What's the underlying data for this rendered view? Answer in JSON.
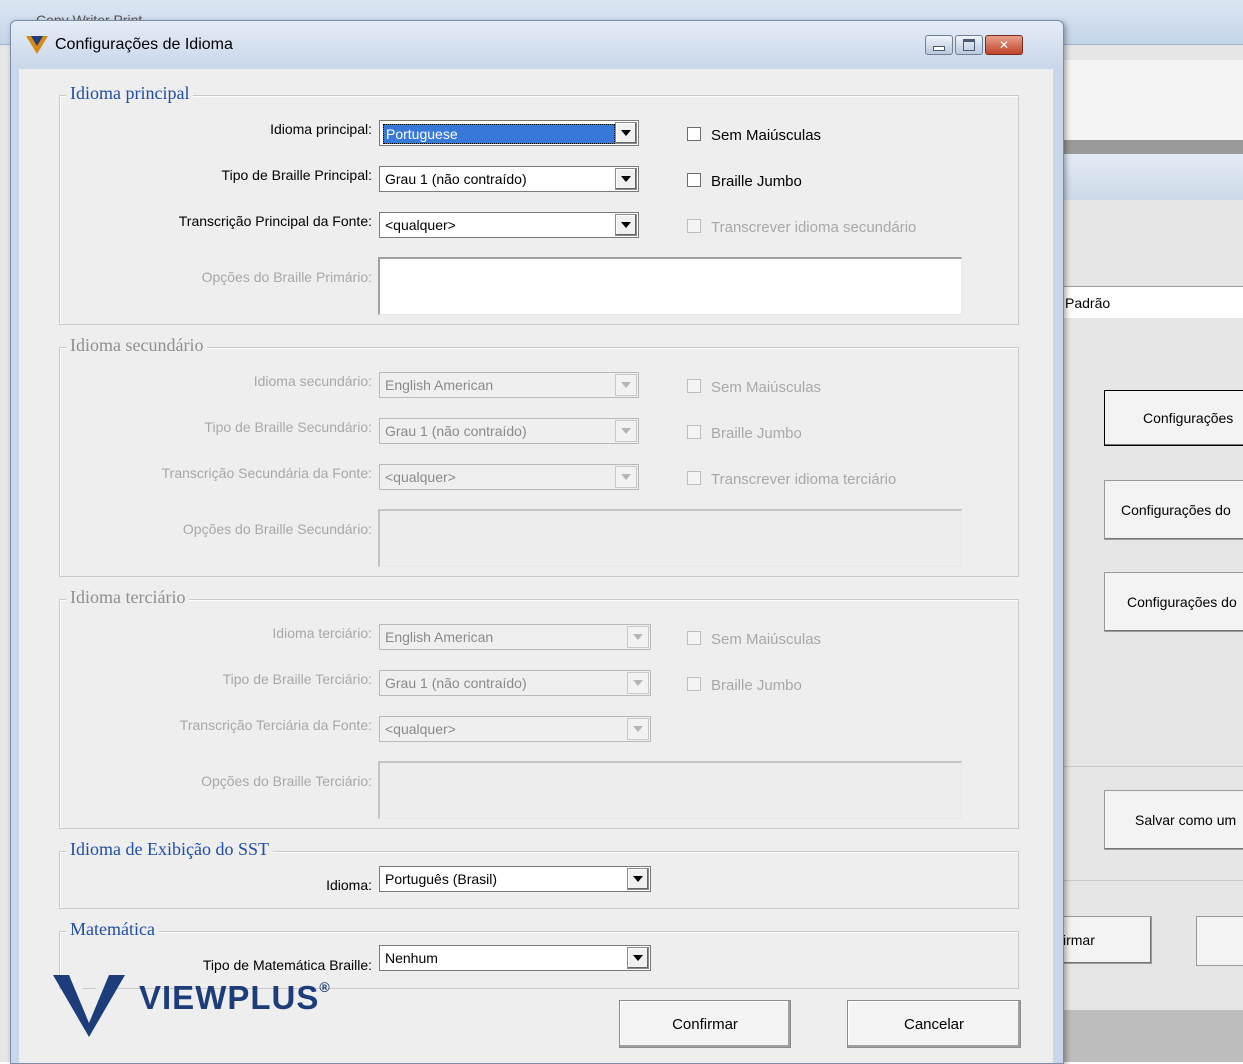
{
  "background_app": {
    "title": "Copy Writer Print",
    "field_value": "Padrão",
    "buttons": [
      "Configurações",
      "Configurações do",
      "Configurações do",
      "Salvar como um",
      "irmar",
      ""
    ]
  },
  "dialog": {
    "title": "Configurações de Idioma",
    "primary": {
      "group_title": "Idioma principal",
      "language_label": "Idioma principal:",
      "language_value": "Portuguese",
      "no_caps_label": "Sem Maiúsculas",
      "braille_type_label": "Tipo de Braille Principal:",
      "braille_type_value": "Grau 1 (não contraído)",
      "jumbo_label": "Braille Jumbo",
      "source_label": "Transcrição Principal da Fonte:",
      "source_value": "<qualquer>",
      "transcribe_label": "Transcrever idioma secundário",
      "options_label": "Opções do Braille Primário:"
    },
    "secondary": {
      "group_title": "Idioma secundário",
      "language_label": "Idioma secundário:",
      "language_value": "English American",
      "no_caps_label": "Sem Maiúsculas",
      "braille_type_label": "Tipo de Braille Secundário:",
      "braille_type_value": "Grau 1 (não contraído)",
      "jumbo_label": "Braille Jumbo",
      "source_label": "Transcrição Secundária da Fonte:",
      "source_value": "<qualquer>",
      "transcribe_label": "Transcrever idioma terciário",
      "options_label": "Opções do Braille Secundário:"
    },
    "tertiary": {
      "group_title": "Idioma terciário",
      "language_label": "Idioma terciário:",
      "language_value": "English American",
      "no_caps_label": "Sem Maiúsculas",
      "braille_type_label": "Tipo de Braille Terciário:",
      "braille_type_value": "Grau 1 (não contraído)",
      "jumbo_label": "Braille Jumbo",
      "source_label": "Transcrição Terciária da Fonte:",
      "source_value": "<qualquer>",
      "options_label": "Opções do Braille Terciário:"
    },
    "display": {
      "group_title": "Idioma de Exibição do SST",
      "language_label": "Idioma:",
      "language_value": "Português (Brasil)"
    },
    "math": {
      "group_title": "Matemática",
      "type_label": "Tipo de Matemática Braille:",
      "type_value": "Nenhum"
    },
    "logo_text": "VIEWPLUS",
    "logo_reg": "®",
    "confirm_label": "Confirmar",
    "cancel_label": "Cancelar"
  },
  "colors": {
    "group_title": "#1e4ea8",
    "selection": "#3778d9",
    "logo": "#1d3d7a"
  }
}
